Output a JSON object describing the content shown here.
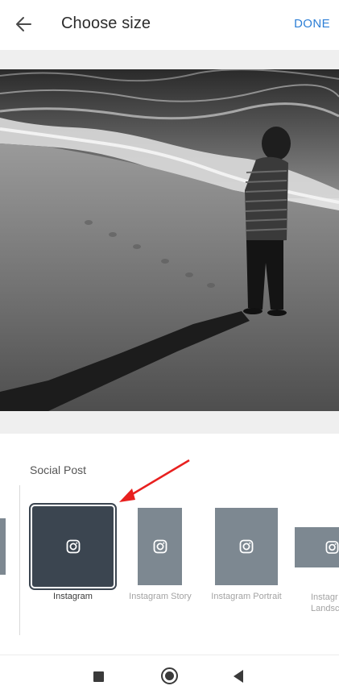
{
  "header": {
    "back_icon": "arrow-left-icon",
    "title": "Choose size",
    "done_label": "DONE",
    "accent_color": "#2d7fd6"
  },
  "preview": {
    "image_subject": "beach photo"
  },
  "panel": {
    "section_label": "Social Post",
    "options": [
      {
        "label": "Instagram",
        "icon": "instagram-icon",
        "selected": true
      },
      {
        "label": "Instagram Story",
        "icon": "instagram-icon",
        "selected": false
      },
      {
        "label": "Instagram Portrait",
        "icon": "instagram-icon",
        "selected": false
      },
      {
        "label": "Instagr Landsc",
        "icon": "instagram-icon",
        "selected": false
      }
    ]
  },
  "annotation": {
    "arrow_color": "#e8201f"
  },
  "navbar": {
    "recents_icon": "square-icon",
    "home_icon": "circle-icon",
    "back_icon": "triangle-back-icon"
  }
}
